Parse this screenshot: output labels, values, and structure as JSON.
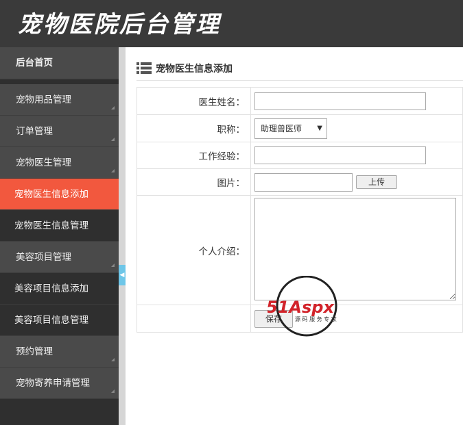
{
  "app": {
    "title": "宠物医院后台管理"
  },
  "sidebar": {
    "home": "后台首页",
    "items": [
      {
        "label": "宠物用品管理"
      },
      {
        "label": "订单管理"
      },
      {
        "label": "宠物医生管理"
      },
      {
        "label": "宠物医生信息添加"
      },
      {
        "label": "宠物医生信息管理"
      },
      {
        "label": "美容项目管理"
      },
      {
        "label": "美容项目信息添加"
      },
      {
        "label": "美容项目信息管理"
      },
      {
        "label": "预约管理"
      },
      {
        "label": "宠物寄养申请管理"
      }
    ]
  },
  "panel": {
    "title": "宠物医生信息添加"
  },
  "form": {
    "name_label": "医生姓名：",
    "name_value": "",
    "title_label": "职称：",
    "title_selected": "助理兽医师",
    "experience_label": "工作经验：",
    "experience_value": "",
    "image_label": "图片：",
    "image_value": "",
    "upload_label": "上传",
    "intro_label": "个人介绍：",
    "intro_value": "",
    "save_label": "保存"
  },
  "watermark": {
    "brand": "51Aspx",
    "slogan": "源 码 服 务 专 家"
  },
  "colors": {
    "header": "#3a3a3a",
    "sidebar": "#2f2f2f",
    "active": "#f2583e",
    "accent": "#6ec6e8"
  }
}
